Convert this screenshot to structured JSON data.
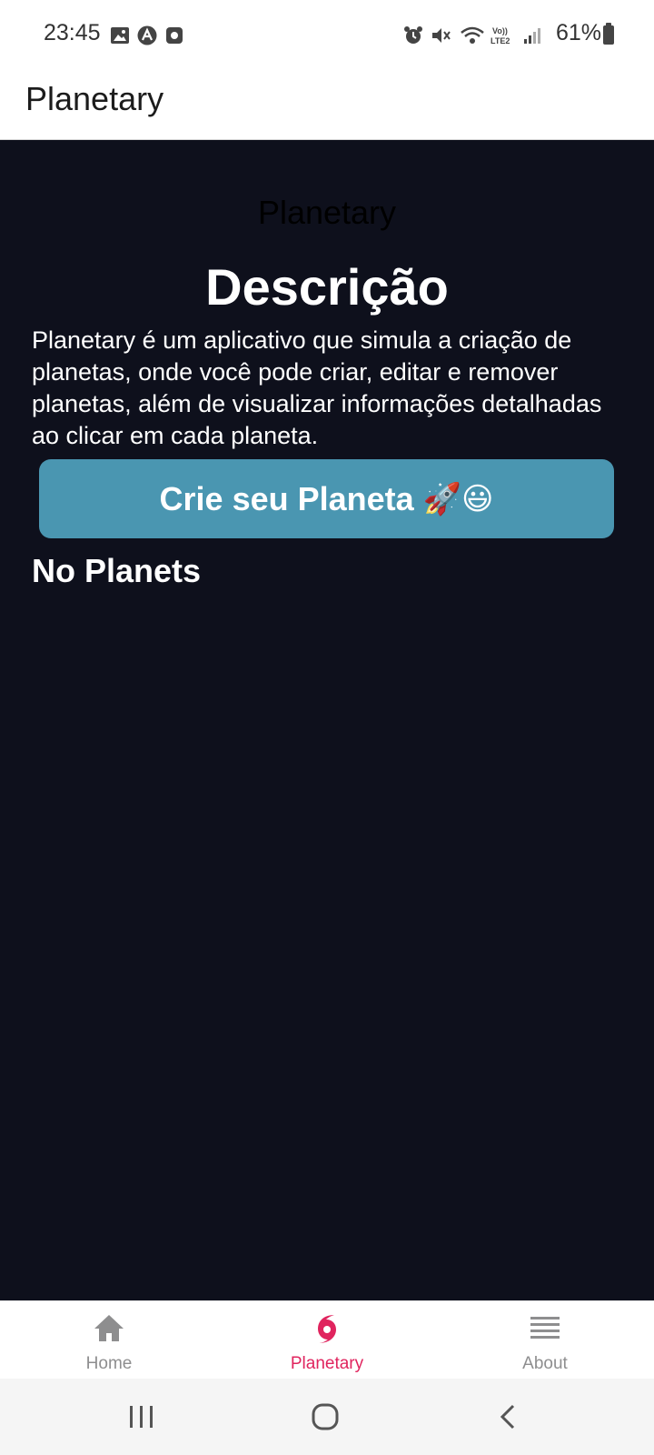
{
  "status_bar": {
    "time": "23:45",
    "battery": "61%",
    "left_icons": [
      "image-icon",
      "a-icon",
      "record-icon"
    ],
    "right_icons": [
      "alarm-icon",
      "mute-icon",
      "wifi-icon",
      "volte-icon",
      "signal-icon",
      "battery-icon"
    ]
  },
  "header": {
    "title": "Planetary"
  },
  "main": {
    "faint_title": "Planetary",
    "heading": "Descrição",
    "description": "Planetary é um aplicativo que simula a criação de planetas, onde você pode criar, editar e remover planetas, além de visualizar informações detalhadas ao clicar em cada planeta.",
    "create_button": {
      "label": "Crie seu Planeta",
      "emoji": "🚀😃"
    },
    "empty_label": "No Planets"
  },
  "tabs": [
    {
      "label": "Home",
      "icon": "home-icon",
      "active": false
    },
    {
      "label": "Planetary",
      "icon": "cyclone-icon",
      "active": true
    },
    {
      "label": "About",
      "icon": "menu-icon",
      "active": false
    }
  ],
  "colors": {
    "background": "#0e101c",
    "button": "#4a96b1",
    "active_tab": "#e0245e",
    "inactive_tab": "#8e8e8f"
  },
  "system_nav": [
    "recents-icon",
    "home-circle-icon",
    "back-icon"
  ]
}
